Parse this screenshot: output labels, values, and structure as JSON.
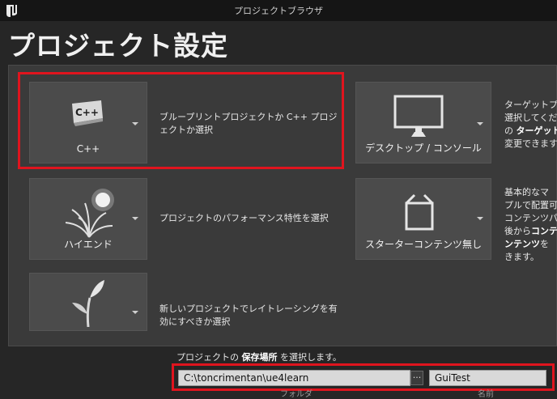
{
  "window": {
    "title": "プロジェクトブラウザ"
  },
  "page": {
    "title": "プロジェクト設定"
  },
  "cards": [
    {
      "label": "C++",
      "icon": "cpp-icon",
      "icon_text": "C++"
    },
    {
      "label": "デスクトップ / コンソール",
      "icon": "monitor-icon"
    },
    {
      "label": "ハイエンド",
      "icon": "high-end-plant-icon"
    },
    {
      "label": "スターターコンテンツ無し",
      "icon": "empty-box-icon"
    },
    {
      "label": "",
      "icon": "sprout-icon"
    }
  ],
  "descriptions": {
    "cpp": [
      "ブループリントプロジェクトか C++ プロジ",
      "ェクトか選択"
    ],
    "target": {
      "line1": "ターゲットプ",
      "line2": "選択してくだ",
      "line3_pre": "の ",
      "line3_bold": "ターゲット",
      "line4": "変更できます"
    },
    "quality": "プロジェクトのパフォーマンス特性を選択",
    "content": {
      "line1": "基本的なマ",
      "line2": "プルで配置可",
      "line3": "コンテンツパ",
      "line4_pre": "後から",
      "line4_bold": "コンテ",
      "line5_bold": "ンテンツ",
      "line5_post": "を",
      "line6": "きます。"
    },
    "raytracing": [
      "新しいプロジェクトでレイトレーシングを有",
      "効にすべきか選択"
    ]
  },
  "save": {
    "label_pre": "プロジェクトの ",
    "label_bold": "保存場所",
    "label_post": " を選択します。",
    "path": "C:\\toncrimentan\\ue4learn",
    "browse": "···",
    "name": "GuiTest"
  },
  "footer": {
    "left": "フォルダ",
    "right": "名前"
  },
  "colors": {
    "highlight": "#e0141e",
    "card": "#4b4b4b",
    "panel": "#3a3a3a",
    "background": "#262626"
  }
}
